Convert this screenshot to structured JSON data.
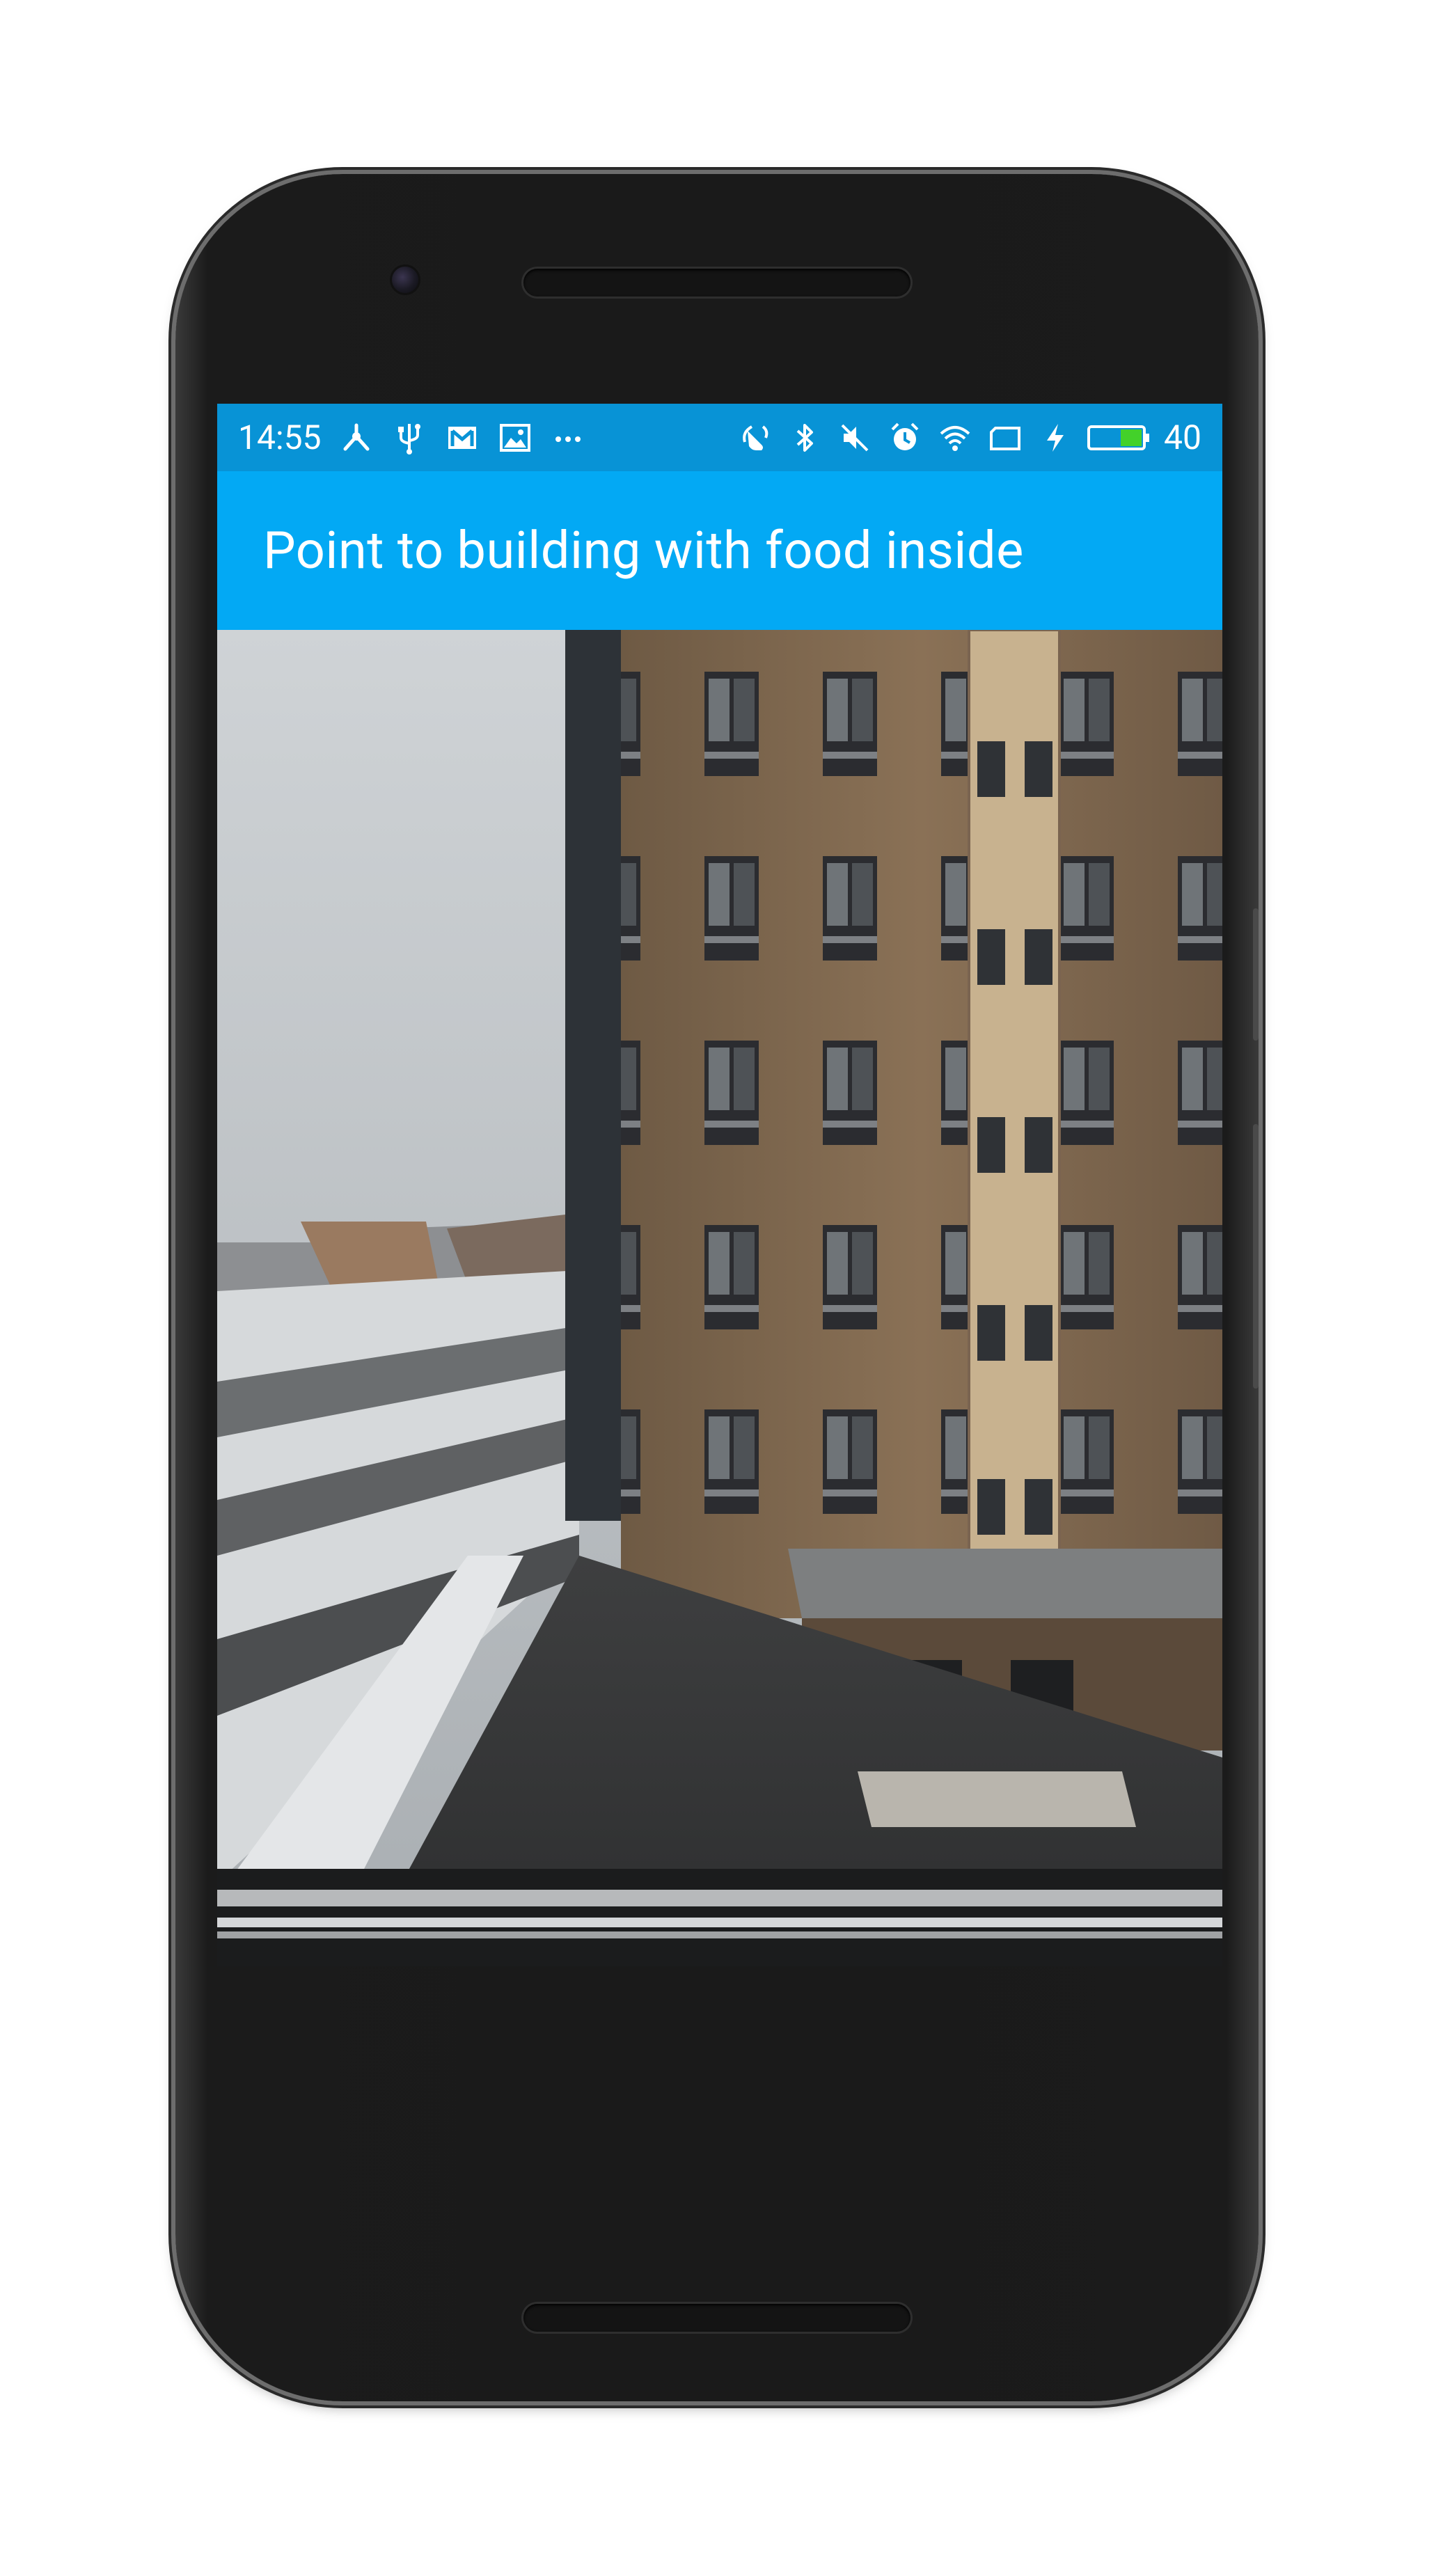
{
  "status_bar": {
    "time": "14:55",
    "left_icons": [
      "graph-icon",
      "usb-icon",
      "gmail-icon",
      "image-icon",
      "more-icon"
    ],
    "right_icons": [
      "screen-rotate-icon",
      "bluetooth-icon",
      "mute-icon",
      "alarm-icon",
      "wifi-icon",
      "screen-icon",
      "charging-icon",
      "battery-icon"
    ],
    "battery_level": "40",
    "background": "#0893d6"
  },
  "app_bar": {
    "title": "Point to building with food inside",
    "background": "#03a9f4"
  },
  "camera_view": {
    "description_icon": "camera-preview"
  }
}
